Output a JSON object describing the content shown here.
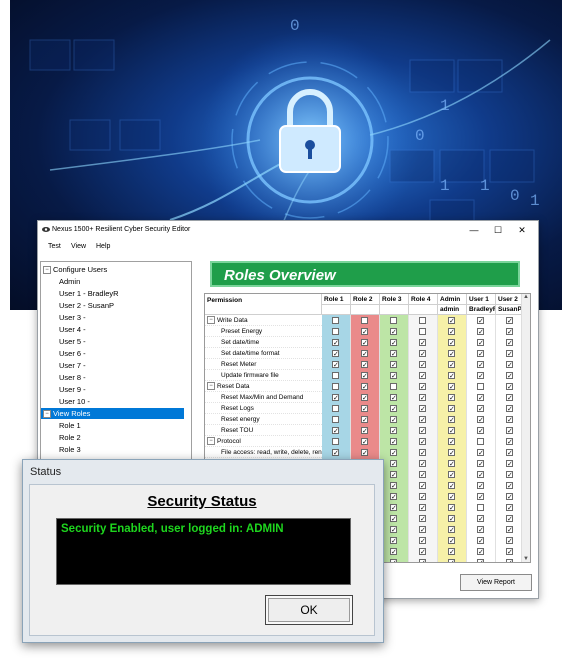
{
  "hero": {
    "binary_digits": [
      "0",
      "1",
      "0",
      "1",
      "1",
      "0",
      "1"
    ]
  },
  "window": {
    "title": "Nexus 1500+ Resilient Cyber Security Editor",
    "controls": {
      "minimize": "—",
      "maximize": "☐",
      "close": "✕"
    }
  },
  "menu": {
    "items": [
      "Test",
      "View",
      "Help"
    ]
  },
  "tree": {
    "configure_users": "Configure Users",
    "users": [
      "Admin",
      "User 1 - BradleyR",
      "User 2 - SusanP",
      "User 3 -",
      "User 4 -",
      "User 5 -",
      "User 6 -",
      "User 7 -",
      "User 8 -",
      "User 9 -",
      "User 10 -"
    ],
    "view_roles": "View Roles",
    "roles": [
      "Role 1",
      "Role 2",
      "Role 3"
    ]
  },
  "roles_overview": {
    "title": "Roles Overview",
    "permission_header": "Permission",
    "columns": [
      "Role 1",
      "Role 2",
      "Role 3",
      "Role 4",
      "Admin",
      "User 1",
      "User 2"
    ],
    "subheaders": [
      "",
      "",
      "",
      "",
      "admin",
      "BradleyR",
      "SusanP"
    ],
    "column_colors": [
      "#a7d6e6",
      "#ea8a8a",
      "#bde5a6",
      "#f5f5f5",
      "#f6f1a8",
      "#ffffff",
      "#ffffff"
    ],
    "rows": [
      {
        "label": "Write Data",
        "group": true,
        "checks": [
          "blank",
          "blank",
          "blank",
          "blank",
          "check",
          "check",
          "check"
        ]
      },
      {
        "label": "Preset Energy",
        "group": false,
        "checks": [
          "blank",
          "check",
          "check",
          "blank",
          "check",
          "check",
          "check"
        ]
      },
      {
        "label": "Set date/time",
        "group": false,
        "checks": [
          "check",
          "check",
          "check",
          "check",
          "check",
          "check",
          "check"
        ]
      },
      {
        "label": "Set date/time format",
        "group": false,
        "checks": [
          "check",
          "check",
          "check",
          "check",
          "check",
          "check",
          "check"
        ]
      },
      {
        "label": "Reset Meter",
        "group": false,
        "checks": [
          "check",
          "check",
          "check",
          "check",
          "check",
          "check",
          "check"
        ]
      },
      {
        "label": "Update firmware file",
        "group": false,
        "checks": [
          "blank",
          "check",
          "check",
          "check",
          "check",
          "check",
          "check"
        ]
      },
      {
        "label": "Reset Data",
        "group": true,
        "checks": [
          "blank",
          "check",
          "blank",
          "check",
          "check",
          "blank",
          "check"
        ]
      },
      {
        "label": "Reset Max/Min and Demand",
        "group": false,
        "checks": [
          "check",
          "check",
          "check",
          "check",
          "check",
          "check",
          "check"
        ]
      },
      {
        "label": "Reset Logs",
        "group": false,
        "checks": [
          "blank",
          "check",
          "check",
          "check",
          "check",
          "check",
          "check"
        ]
      },
      {
        "label": "Reset energy",
        "group": false,
        "checks": [
          "blank",
          "check",
          "check",
          "check",
          "check",
          "check",
          "check"
        ]
      },
      {
        "label": "Reset TOU",
        "group": false,
        "checks": [
          "check",
          "check",
          "check",
          "check",
          "check",
          "check",
          "check"
        ]
      },
      {
        "label": "Protocol",
        "group": true,
        "checks": [
          "blank",
          "check",
          "check",
          "check",
          "check",
          "blank",
          "check"
        ]
      },
      {
        "label": "File access: read, write, delete, rename",
        "group": false,
        "checks": [
          "check",
          "check",
          "check",
          "check",
          "check",
          "check",
          "check"
        ]
      },
      {
        "label": "",
        "group": false,
        "checks": [
          "blank",
          "check",
          "check",
          "check",
          "check",
          "check",
          "check"
        ]
      },
      {
        "label": "",
        "group": false,
        "checks": [
          "blank",
          "check",
          "check",
          "check",
          "check",
          "check",
          "check"
        ]
      },
      {
        "label": "",
        "group": false,
        "checks": [
          "blank",
          "check",
          "check",
          "check",
          "check",
          "check",
          "check"
        ]
      },
      {
        "label": "",
        "group": false,
        "checks": [
          "blank",
          "check",
          "check",
          "check",
          "check",
          "check",
          "check"
        ]
      },
      {
        "label": "",
        "group": false,
        "checks": [
          "blank",
          "check",
          "check",
          "check",
          "check",
          "blank",
          "check"
        ]
      },
      {
        "label": "",
        "group": false,
        "checks": [
          "blank",
          "check",
          "check",
          "check",
          "check",
          "check",
          "check"
        ]
      },
      {
        "label": "",
        "group": false,
        "checks": [
          "blank",
          "check",
          "check",
          "check",
          "check",
          "check",
          "check"
        ]
      },
      {
        "label": "",
        "group": false,
        "checks": [
          "blank",
          "check",
          "check",
          "check",
          "check",
          "check",
          "check"
        ]
      },
      {
        "label": "",
        "group": false,
        "checks": [
          "blank",
          "check",
          "check",
          "check",
          "check",
          "check",
          "check"
        ]
      },
      {
        "label": "",
        "group": false,
        "checks": [
          "blank",
          "check",
          "check",
          "check",
          "check",
          "check",
          "check"
        ]
      }
    ],
    "view_report": "View Report"
  },
  "status_dialog": {
    "title": "Status",
    "heading": "Security Status",
    "message": "Security Enabled, user logged in: ADMIN",
    "ok_label": "OK"
  }
}
